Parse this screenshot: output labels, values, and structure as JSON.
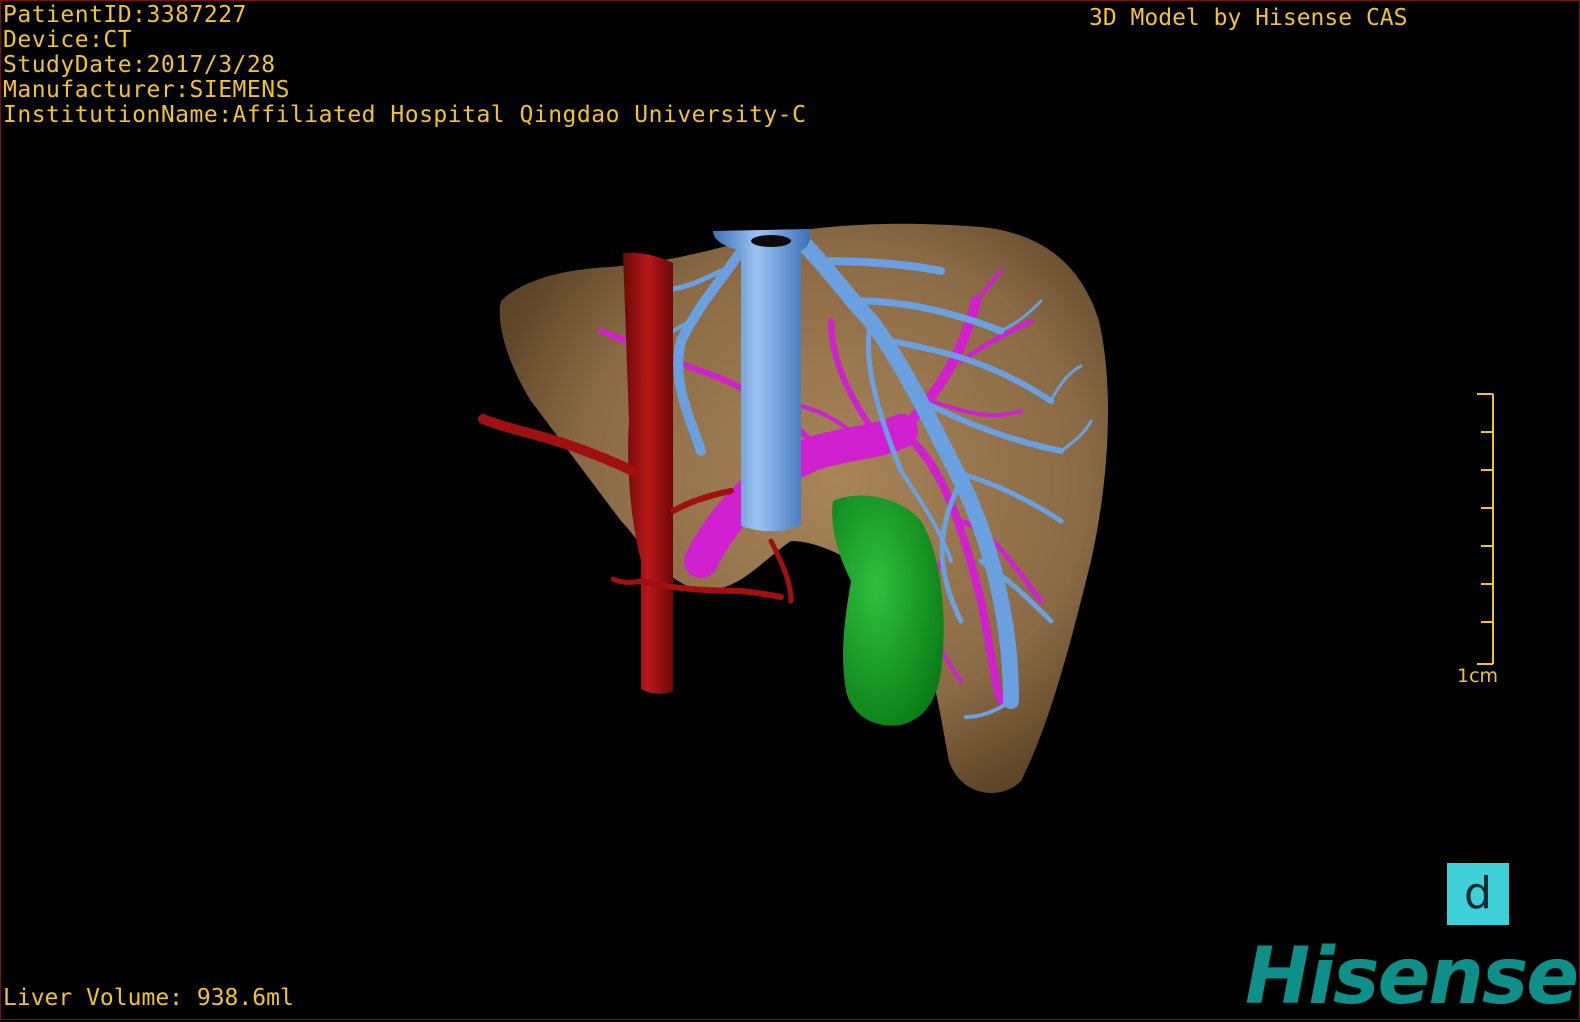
{
  "overlay": {
    "patient_id": "PatientID:3387227",
    "device": "Device:CT",
    "study_date": "StudyDate:2017/3/28",
    "manufacturer": "Manufacturer:SIEMENS",
    "institution": "InstitutionName:Affiliated Hospital Qingdao University-C",
    "credit": "3D Model by Hisense CAS",
    "liver_volume": "Liver Volume: 938.6ml"
  },
  "scale_bar": {
    "label": "1cm"
  },
  "orientation_cube": {
    "face_label": "d"
  },
  "brand": {
    "logo_text": "Hisense"
  },
  "colors": {
    "overlay_text": "#f2c230",
    "liver": "#8a6a45",
    "hepatic_vein": "#6aa0e0",
    "portal_vein": "#d020d0",
    "artery": "#a01010",
    "gallbladder": "#10a020",
    "brand": "#0e8f8a",
    "orientation_cube": "#3fd0d8"
  }
}
